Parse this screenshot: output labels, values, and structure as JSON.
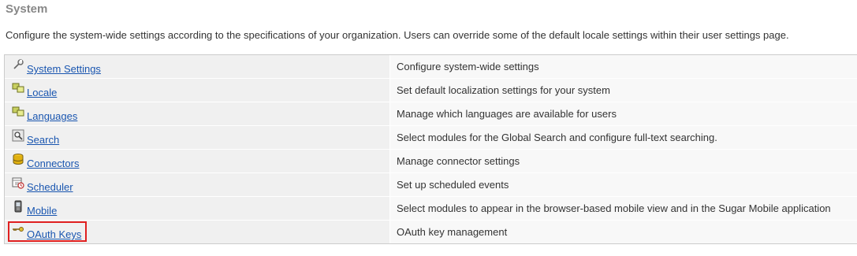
{
  "section": {
    "title": "System",
    "description": "Configure the system-wide settings according to the specifications of your organization. Users can override some of the default locale settings within their user settings page."
  },
  "items": [
    {
      "label": "System Settings",
      "description": "Configure system-wide settings",
      "icon": "wrench-icon"
    },
    {
      "label": "Locale",
      "description": "Set default localization settings for your system",
      "icon": "locale-icon"
    },
    {
      "label": "Languages",
      "description": "Manage which languages are available for users",
      "icon": "languages-icon"
    },
    {
      "label": "Search",
      "description": "Select modules for the Global Search and configure full-text searching.",
      "icon": "search-icon"
    },
    {
      "label": "Connectors",
      "description": "Manage connector settings",
      "icon": "connectors-icon"
    },
    {
      "label": "Scheduler",
      "description": "Set up scheduled events",
      "icon": "scheduler-icon"
    },
    {
      "label": "Mobile",
      "description": "Select modules to appear in the browser-based mobile view and in the Sugar Mobile application",
      "icon": "mobile-icon"
    },
    {
      "label": "OAuth Keys",
      "description": "OAuth key management",
      "icon": "key-icon"
    }
  ],
  "colors": {
    "link": "#1a56b0",
    "highlight": "#e02020",
    "title": "#888888"
  }
}
